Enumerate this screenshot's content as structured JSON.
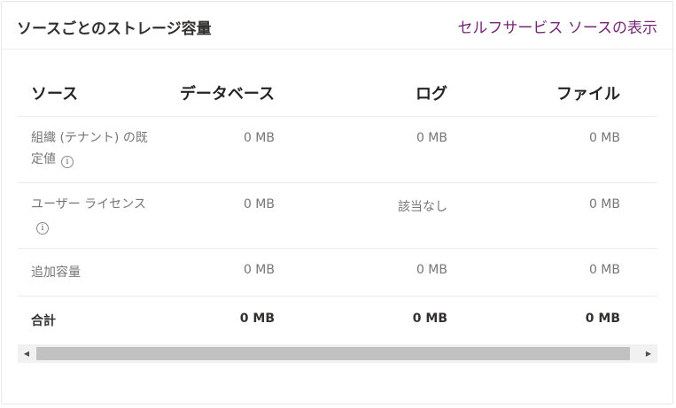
{
  "card": {
    "title": "ソースごとのストレージ容量",
    "link": "セルフサービス ソースの表示"
  },
  "table": {
    "headers": {
      "source": "ソース",
      "database": "データベース",
      "log": "ログ",
      "file": "ファイル"
    },
    "rows": [
      {
        "source": "組織 (テナント) の既定値",
        "database": "0 MB",
        "log": "0 MB",
        "file": "0 MB",
        "info": "i"
      },
      {
        "source": "ユーザー ライセンス",
        "database": "0 MB",
        "log": "該当なし",
        "file": "0 MB",
        "info": "i"
      },
      {
        "source": "追加容量",
        "database": "0 MB",
        "log": "0 MB",
        "file": "0 MB"
      }
    ],
    "total": {
      "source": "合計",
      "database": "0 MB",
      "log": "0 MB",
      "file": "0 MB"
    }
  },
  "scrollbar": {
    "left_arrow": "◀",
    "right_arrow": "▶"
  }
}
